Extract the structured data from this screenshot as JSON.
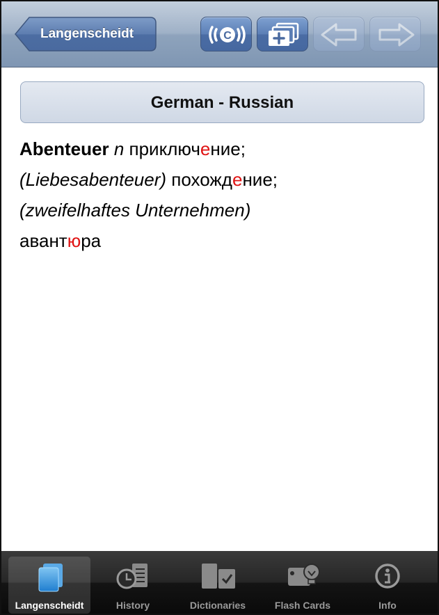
{
  "navbar": {
    "back_label": "Langenscheidt",
    "buttons": [
      {
        "icon": "speaker-icon",
        "enabled": true
      },
      {
        "icon": "add-flashcard-icon",
        "enabled": true
      },
      {
        "icon": "back-arrow-icon",
        "enabled": false
      },
      {
        "icon": "forward-arrow-icon",
        "enabled": false
      }
    ]
  },
  "section": {
    "title": "German - Russian"
  },
  "entry": {
    "headword": "Abenteuer",
    "gender": "n",
    "tr1_a": "приключ",
    "tr1_b": "е",
    "tr1_c": "ние",
    "sep1": ";",
    "gloss1": "(Liebesabenteuer)",
    "tr2_a": "похожд",
    "tr2_b": "е",
    "tr2_c": "ние",
    "sep2": ";",
    "gloss2": "(zweifelhaftes Unternehmen)",
    "tr3_a": "авант",
    "tr3_b": "ю",
    "tr3_c": "ра"
  },
  "tabbar": {
    "tabs": [
      {
        "label": "Langenscheidt",
        "icon": "book-icon",
        "active": true
      },
      {
        "label": "History",
        "icon": "clock-list-icon",
        "active": false
      },
      {
        "label": "Dictionaries",
        "icon": "dictionaries-icon",
        "active": false
      },
      {
        "label": "Flash Cards",
        "icon": "flash-cards-icon",
        "active": false
      },
      {
        "label": "Info",
        "icon": "info-icon",
        "active": false
      }
    ]
  },
  "colors": {
    "accent_stress": "#e01414",
    "navbar": "#8ea3bc",
    "tabbar": "#1a1a1a"
  }
}
